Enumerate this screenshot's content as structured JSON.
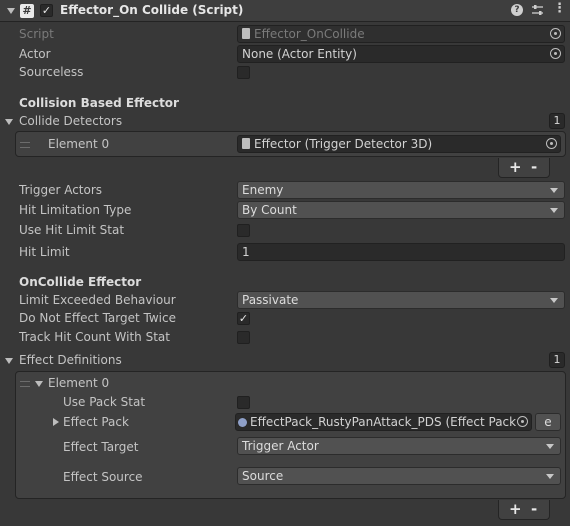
{
  "header": {
    "title": "Effector_On Collide (Script)",
    "script_icon": "#",
    "enabled": true
  },
  "fields": {
    "script": {
      "label": "Script",
      "value": "Effector_OnCollide"
    },
    "actor": {
      "label": "Actor",
      "value": "None (Actor Entity)"
    },
    "sourceless": {
      "label": "Sourceless",
      "checked": false
    }
  },
  "collision": {
    "section_title": "Collision Based Effector",
    "detectors": {
      "label": "Collide Detectors",
      "count": "1",
      "element_label": "Element 0",
      "element_value": "Effector (Trigger Detector 3D)"
    },
    "trigger_actors": {
      "label": "Trigger Actors",
      "value": "Enemy"
    },
    "hit_limitation_type": {
      "label": "Hit Limitation Type",
      "value": "By Count"
    },
    "use_hit_limit_stat": {
      "label": "Use Hit Limit Stat",
      "checked": false
    },
    "hit_limit": {
      "label": "Hit Limit",
      "value": "1"
    }
  },
  "oncollide": {
    "section_title": "OnCollide Effector",
    "limit_exceeded": {
      "label": "Limit Exceeded Behaviour",
      "value": "Passivate"
    },
    "do_not_effect_twice": {
      "label": "Do Not Effect Target Twice",
      "checked": true
    },
    "track_hit_count": {
      "label": "Track Hit Count With Stat",
      "checked": false
    }
  },
  "effects": {
    "label": "Effect Definitions",
    "count": "1",
    "element_label": "Element 0",
    "use_pack_stat": {
      "label": "Use Pack Stat",
      "checked": false
    },
    "effect_pack": {
      "label": "Effect Pack",
      "value": "EffectPack_RustyPanAttack_PDS (Effect Pack",
      "button": "e"
    },
    "effect_target": {
      "label": "Effect Target",
      "value": "Trigger Actor"
    },
    "effect_source": {
      "label": "Effect Source",
      "value": "Source"
    }
  },
  "list_controls": {
    "add": "+",
    "remove": "-"
  },
  "icons": {
    "help": "help-icon",
    "presets": "sliders-icon",
    "menu": "kebab-menu-icon",
    "picker": "object-picker-icon"
  }
}
